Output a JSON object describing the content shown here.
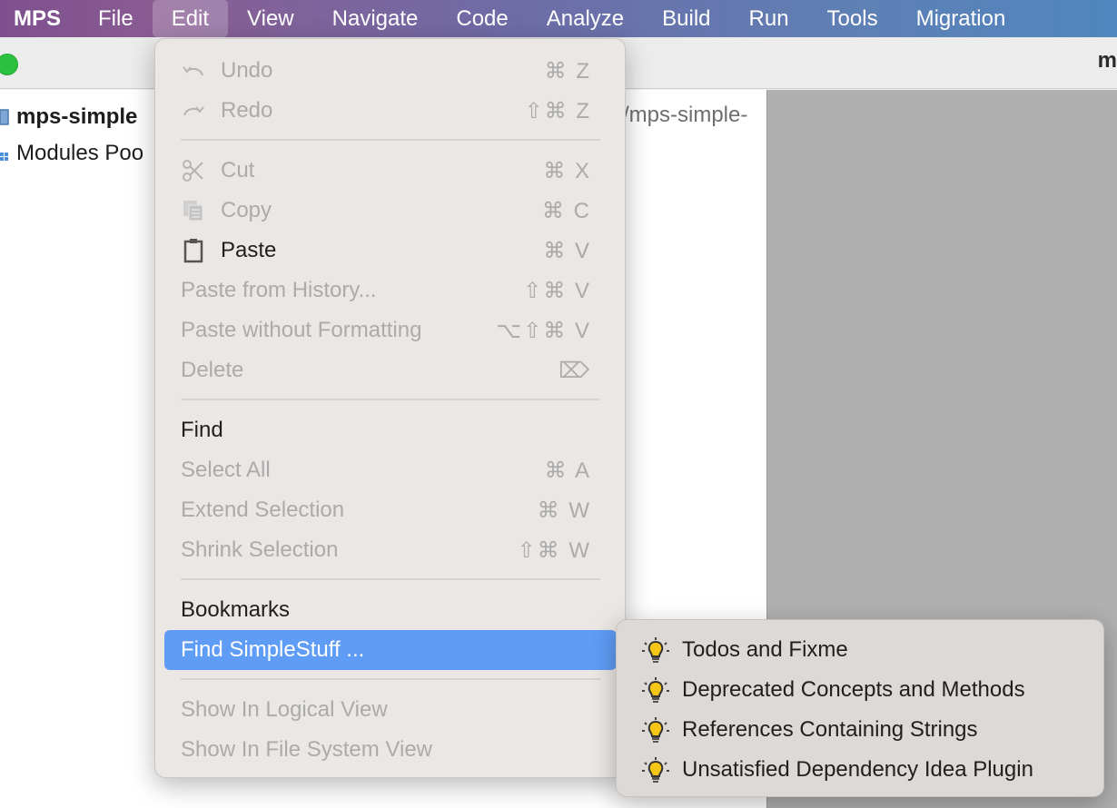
{
  "menubar": {
    "items": [
      "MPS",
      "File",
      "Edit",
      "View",
      "Navigate",
      "Code",
      "Analyze",
      "Build",
      "Run",
      "Tools",
      "Migration"
    ]
  },
  "window": {
    "title_fragment": "m"
  },
  "project_tree": {
    "root_label": "mps-simple",
    "modules_pool_label": "Modules Poo",
    "path_fragment": "/mps-simple-"
  },
  "edit_menu": {
    "undo": {
      "label": "Undo",
      "shortcut": "⌘ Z"
    },
    "redo": {
      "label": "Redo",
      "shortcut": "⇧⌘ Z"
    },
    "cut": {
      "label": "Cut",
      "shortcut": "⌘ X"
    },
    "copy": {
      "label": "Copy",
      "shortcut": "⌘ C"
    },
    "paste": {
      "label": "Paste",
      "shortcut": "⌘ V"
    },
    "paste_history": {
      "label": "Paste from History...",
      "shortcut": "⇧⌘ V"
    },
    "paste_plain": {
      "label": "Paste without Formatting",
      "shortcut": "⌥⇧⌘ V"
    },
    "delete": {
      "label": "Delete",
      "shortcut": "⌦"
    },
    "find": {
      "label": "Find"
    },
    "select_all": {
      "label": "Select All",
      "shortcut": "⌘ A"
    },
    "extend_selection": {
      "label": "Extend Selection",
      "shortcut": "⌘ W"
    },
    "shrink_selection": {
      "label": "Shrink Selection",
      "shortcut": "⇧⌘ W"
    },
    "bookmarks": {
      "label": "Bookmarks"
    },
    "find_simplestuff": {
      "label": "Find SimpleStuff ..."
    },
    "show_logical": {
      "label": "Show In Logical View"
    },
    "show_filesystem": {
      "label": "Show In File System View"
    }
  },
  "submenu": {
    "items": [
      "Todos and Fixme",
      "Deprecated Concepts and Methods",
      "References Containing Strings",
      "Unsatisfied Dependency Idea Plugin"
    ],
    "icon": "lightbulb-icon"
  },
  "colors": {
    "selection": "#5f9cf5",
    "menu_background": "#ebe7e4",
    "disabled_text": "#ababab",
    "bulb": "#f5c518"
  }
}
